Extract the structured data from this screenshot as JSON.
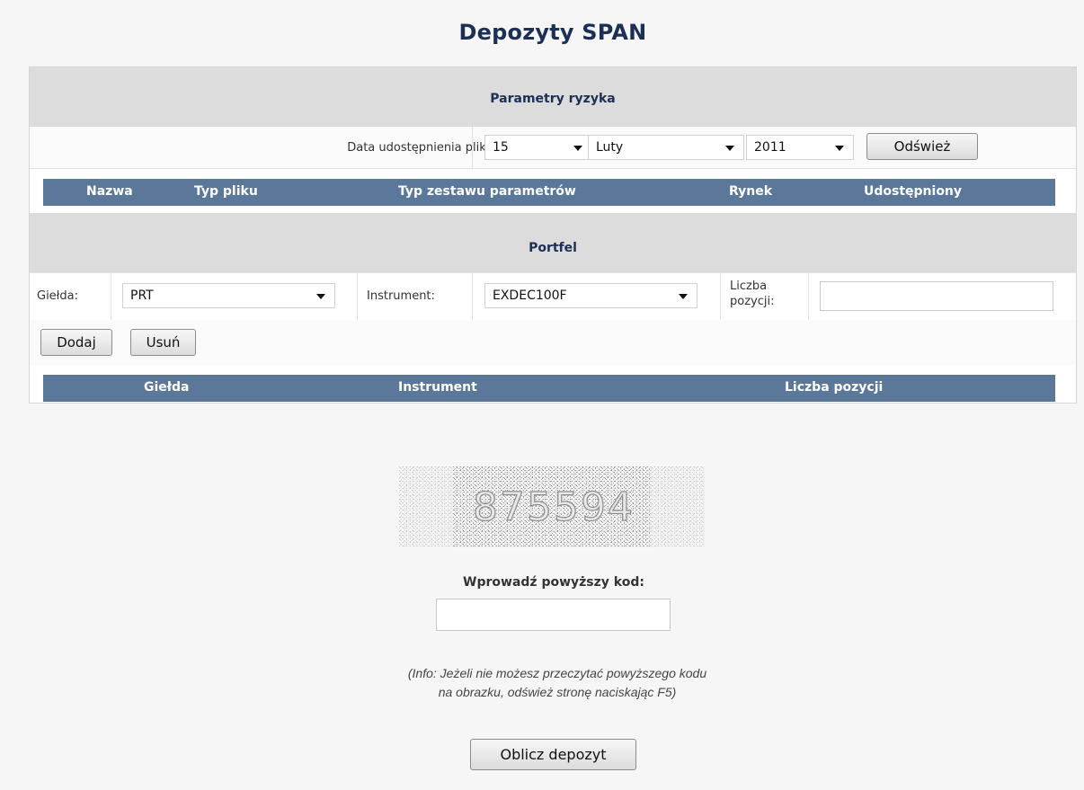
{
  "page": {
    "title": "Depozyty SPAN"
  },
  "risk": {
    "section_title": "Parametry ryzyka",
    "date_label": "Data udostępnienia pliku:",
    "day": "15",
    "month": "Luty",
    "year": "2011",
    "refresh_label": "Odśwież",
    "columns": [
      "Nazwa",
      "Typ pliku",
      "Typ zestawu parametrów",
      "Rynek",
      "Udostępniony"
    ]
  },
  "portfolio": {
    "section_title": "Portfel",
    "exchange_label": "Giełda:",
    "exchange_value": "PRT",
    "instrument_label": "Instrument:",
    "instrument_value": "EXDEC100F",
    "positions_label_line1": "Liczba",
    "positions_label_line2": "pozycji:",
    "positions_value": "",
    "add_label": "Dodaj",
    "remove_label": "Usuń",
    "columns": [
      "Giełda",
      "Instrument",
      "Liczba pozycji"
    ]
  },
  "captcha": {
    "code": "875594",
    "input_label": "Wprowadź powyższy kod:",
    "input_value": "",
    "info_line1": "(Info: Jeżeli nie możesz przeczytać powyższego kodu",
    "info_line2": "na obrazku, odśwież stronę naciskając F5)"
  },
  "submit_label": "Oblicz depozyt"
}
